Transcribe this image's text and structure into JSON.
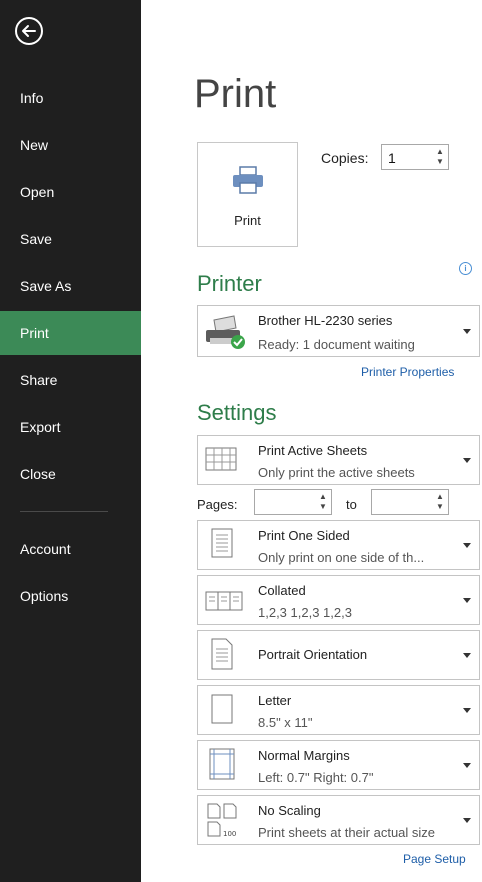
{
  "sidebar": {
    "items": [
      {
        "label": "Info"
      },
      {
        "label": "New"
      },
      {
        "label": "Open"
      },
      {
        "label": "Save"
      },
      {
        "label": "Save As"
      },
      {
        "label": "Print"
      },
      {
        "label": "Share"
      },
      {
        "label": "Export"
      },
      {
        "label": "Close"
      },
      {
        "label": "Account"
      },
      {
        "label": "Options"
      }
    ],
    "active": "Print",
    "colors": {
      "background": "#1f1f1f",
      "active": "#3c8a57"
    }
  },
  "main": {
    "title": "Print",
    "print_button_label": "Print",
    "copies_label": "Copies:",
    "copies_value": "1",
    "printer_header": "Printer",
    "printer_name": "Brother HL-2230 series",
    "printer_status": "Ready: 1 document waiting",
    "printer_properties_link": "Printer Properties",
    "settings_header": "Settings",
    "settings": [
      {
        "title": "Print Active Sheets",
        "subtitle": "Only print the active sheets"
      },
      {
        "title": "Print One Sided",
        "subtitle": "Only print on one side of th..."
      },
      {
        "title": "Collated",
        "subtitle": "1,2,3   1,2,3   1,2,3"
      },
      {
        "title": "Portrait Orientation",
        "subtitle": ""
      },
      {
        "title": "Letter",
        "subtitle": "8.5\" x 11\""
      },
      {
        "title": "Normal Margins",
        "subtitle": "Left:  0.7\"   Right:  0.7\""
      },
      {
        "title": "No Scaling",
        "subtitle": "Print sheets at their actual size"
      }
    ],
    "pages_label": "Pages:",
    "pages_to_label": "to",
    "page_setup_link": "Page Setup",
    "colors": {
      "accent": "#2e7d4a",
      "link": "#1e5ea8"
    }
  }
}
